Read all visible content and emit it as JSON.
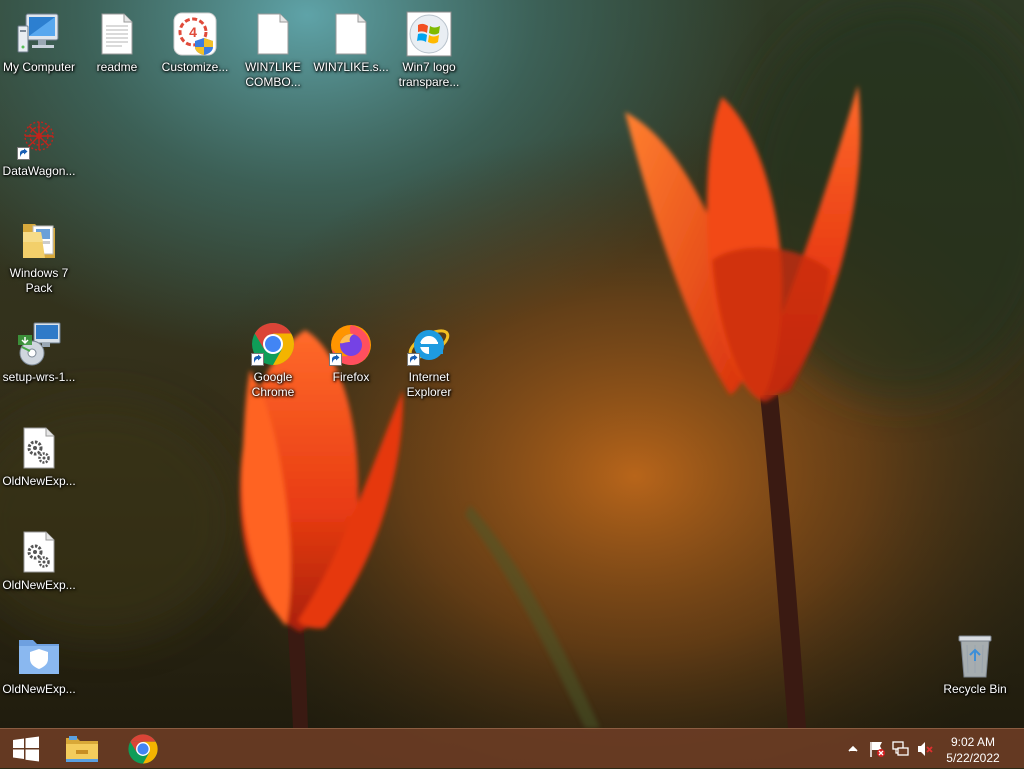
{
  "desktop": {
    "icons": [
      {
        "label": "My Computer",
        "icon": "computer-icon"
      },
      {
        "label": "readme",
        "icon": "text-file-icon"
      },
      {
        "label": "Customize...",
        "icon": "customize-shield-icon"
      },
      {
        "label": "WIN7LIKE COMBO...",
        "icon": "blank-file-icon"
      },
      {
        "label": "WIN7LIKE.s...",
        "icon": "blank-file-icon"
      },
      {
        "label": "Win7 logo transpare...",
        "icon": "windows-logo-image-icon"
      },
      {
        "label": "DataWagon...",
        "icon": "datawagon-icon"
      },
      {
        "label": "Windows 7 Pack",
        "icon": "folder-icon"
      },
      {
        "label": "setup-wrs-1...",
        "icon": "setup-installer-icon"
      },
      {
        "label": "OldNewExp...",
        "icon": "settings-file-icon"
      },
      {
        "label": "OldNewExp...",
        "icon": "settings-file-icon"
      },
      {
        "label": "OldNewExp...",
        "icon": "shield-folder-icon"
      },
      {
        "label": "Google Chrome",
        "icon": "chrome-icon"
      },
      {
        "label": "Firefox",
        "icon": "firefox-icon"
      },
      {
        "label": "Internet Explorer",
        "icon": "ie-icon"
      },
      {
        "label": "Recycle Bin",
        "icon": "recycle-bin-icon"
      }
    ]
  },
  "taskbar": {
    "start": "start-icon",
    "pinned": [
      "file-explorer-icon",
      "chrome-icon"
    ],
    "tray": [
      "show-hidden-icons-chevron-icon",
      "action-center-flag-icon",
      "network-icon",
      "volume-muted-icon"
    ],
    "clock": {
      "time": "9:02 AM",
      "date": "5/22/2022"
    }
  },
  "colors": {
    "taskbar": "#6e3e26",
    "accent_red": "#e84020",
    "chrome_red": "#db4437",
    "chrome_green": "#0f9d58",
    "chrome_yellow": "#f4b400",
    "chrome_blue": "#4285f4"
  }
}
